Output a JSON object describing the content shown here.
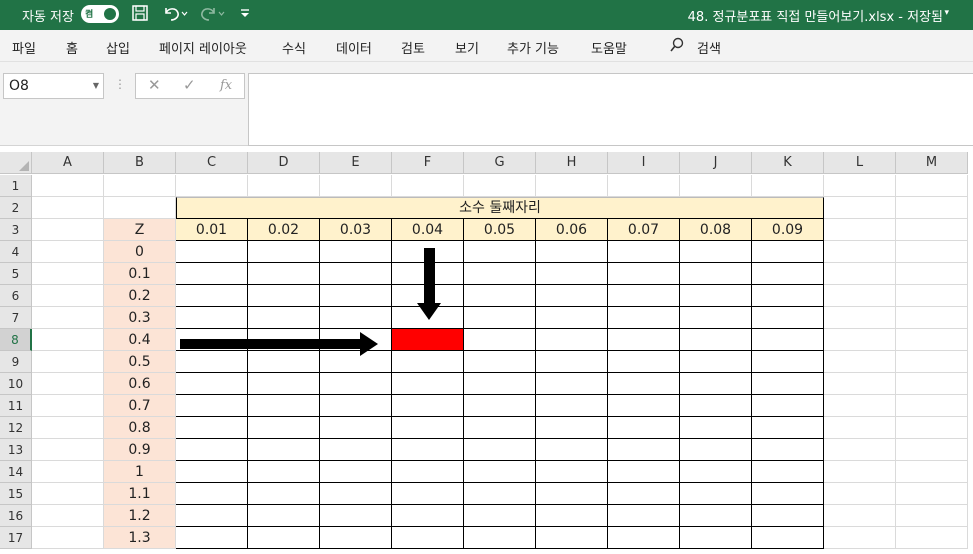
{
  "titlebar": {
    "autosave_label": "자동 저장",
    "autosave_toggle": "켬",
    "document_title": "48. 정규분포표 직접 만들어보기.xlsx - 저장됨",
    "save_icon": "save-icon",
    "undo_icon": "undo-icon",
    "redo_icon": "redo-icon",
    "customize_icon": "customize-qat-icon",
    "accent": "#217346"
  },
  "menu": {
    "tabs": [
      "파일",
      "홈",
      "삽입",
      "페이지 레이아웃",
      "수식",
      "데이터",
      "검토",
      "보기",
      "추가 기능",
      "도움말"
    ],
    "search_label": "검색"
  },
  "formula_bar": {
    "name_box": "O8",
    "cancel_icon": "✕",
    "enter_icon": "✓",
    "fx_label": "fx",
    "formula": ""
  },
  "sheet": {
    "columns": [
      "A",
      "B",
      "C",
      "D",
      "E",
      "F",
      "G",
      "H",
      "I",
      "J",
      "K",
      "L",
      "M"
    ],
    "rows": [
      "1",
      "2",
      "3",
      "4",
      "5",
      "6",
      "7",
      "8",
      "9",
      "10",
      "11",
      "12",
      "13",
      "14",
      "15",
      "16",
      "17"
    ],
    "active_row": "8",
    "merged_header": "소수 둘째자리",
    "z_header": "Z",
    "decimal_headers": [
      "0.01",
      "0.02",
      "0.03",
      "0.04",
      "0.05",
      "0.06",
      "0.07",
      "0.08",
      "0.09"
    ],
    "z_values": [
      "0",
      "0.1",
      "0.2",
      "0.3",
      "0.4",
      "0.5",
      "0.6",
      "0.7",
      "0.8",
      "0.9",
      "1",
      "1.1",
      "1.2",
      "1.3"
    ],
    "highlight_color": "#ff0000",
    "z_fill": "#fce4d6",
    "header_fill": "#fff2cc"
  }
}
